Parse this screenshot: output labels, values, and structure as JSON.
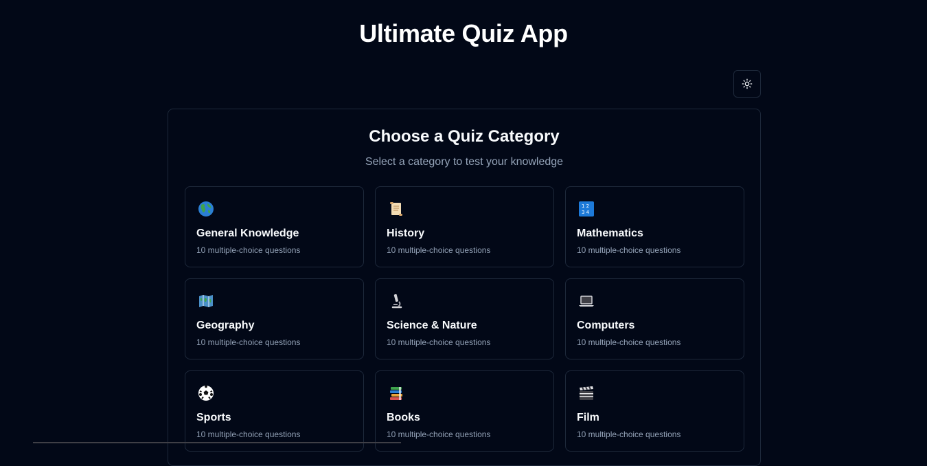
{
  "app": {
    "title": "Ultimate Quiz App"
  },
  "theme_toggle": {
    "icon": "sun-icon"
  },
  "selector": {
    "title": "Choose a Quiz Category",
    "subtitle": "Select a category to test your knowledge"
  },
  "categories": [
    {
      "name": "General Knowledge",
      "desc": "10 multiple-choice questions",
      "icon": "globe-icon"
    },
    {
      "name": "History",
      "desc": "10 multiple-choice questions",
      "icon": "scroll-icon"
    },
    {
      "name": "Mathematics",
      "desc": "10 multiple-choice questions",
      "icon": "numbers-icon"
    },
    {
      "name": "Geography",
      "desc": "10 multiple-choice questions",
      "icon": "map-icon"
    },
    {
      "name": "Science & Nature",
      "desc": "10 multiple-choice questions",
      "icon": "microscope-icon"
    },
    {
      "name": "Computers",
      "desc": "10 multiple-choice questions",
      "icon": "laptop-icon"
    },
    {
      "name": "Sports",
      "desc": "10 multiple-choice questions",
      "icon": "soccer-ball-icon"
    },
    {
      "name": "Books",
      "desc": "10 multiple-choice questions",
      "icon": "books-icon"
    },
    {
      "name": "Film",
      "desc": "10 multiple-choice questions",
      "icon": "clapperboard-icon"
    }
  ],
  "colors": {
    "background": "#020817",
    "border": "#1e293b",
    "muted_text": "#94a3b8",
    "text": "#f8fafc"
  }
}
